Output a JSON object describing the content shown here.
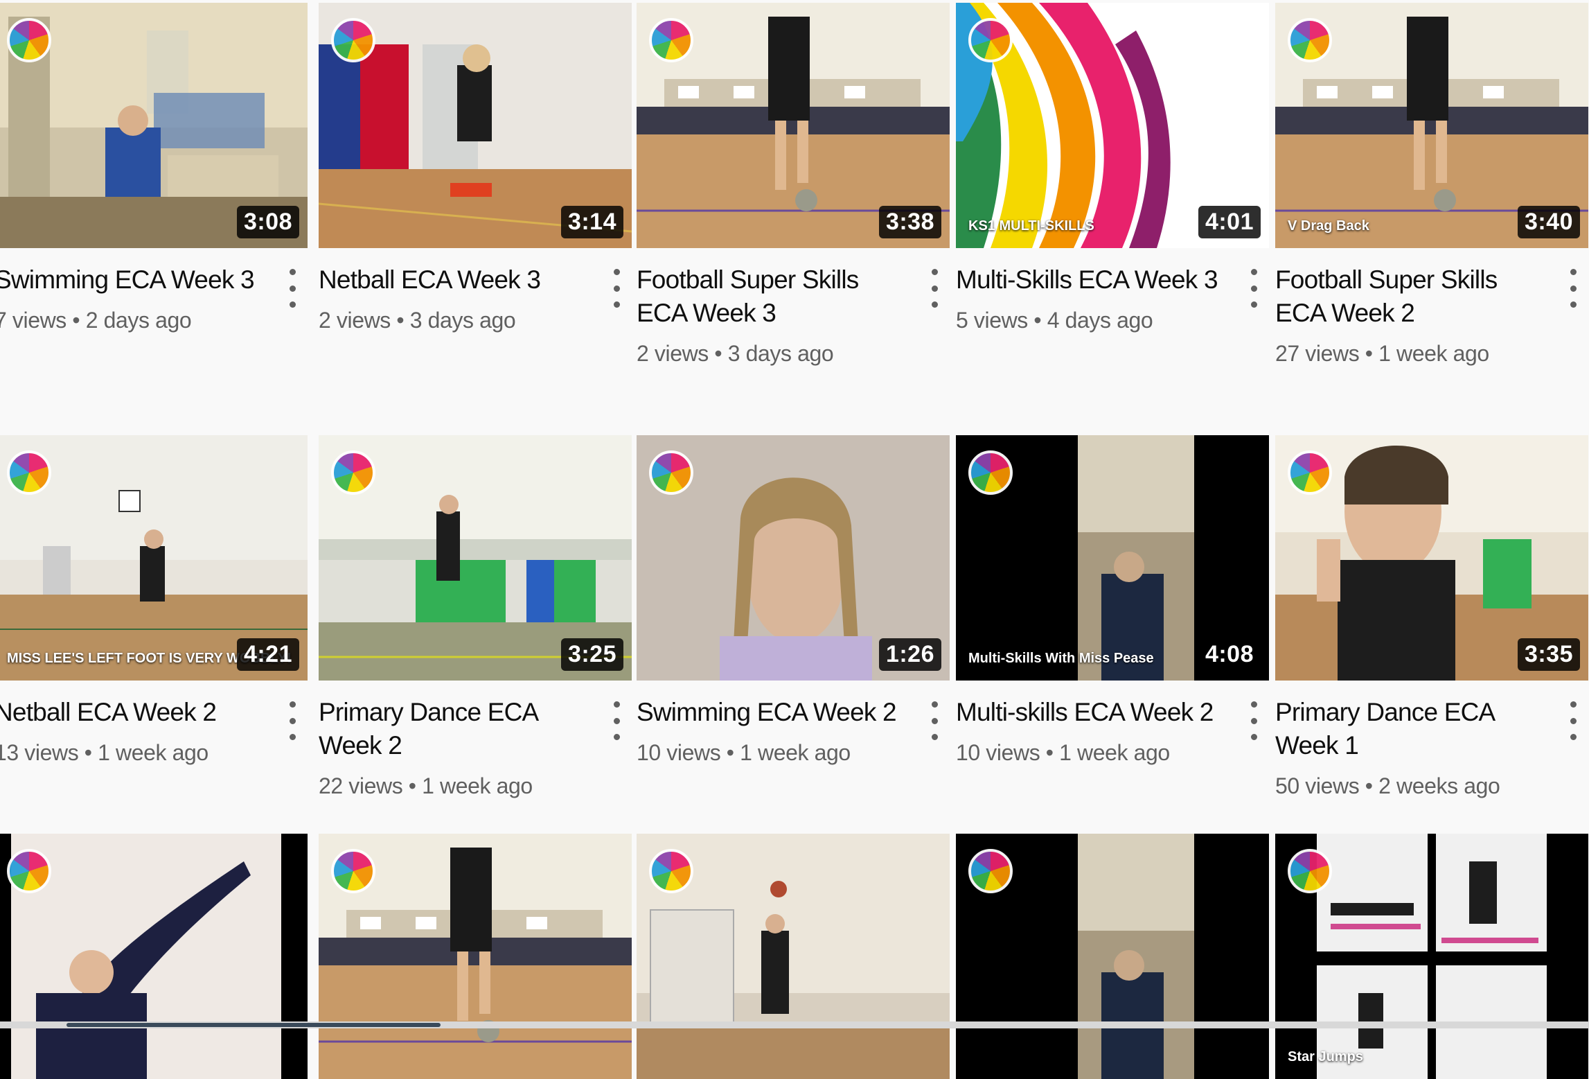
{
  "videos": [
    {
      "title": "Swimming ECA Week 3",
      "views": "7 views",
      "age": "2 days ago",
      "duration": "3:08",
      "thumb_scene": "pool-room"
    },
    {
      "title": "Netball ECA Week 3",
      "views": "2 views",
      "age": "3 days ago",
      "duration": "3:14",
      "thumb_scene": "netball-wall"
    },
    {
      "title": "Football Super Skills ECA Week 3",
      "views": "2 views",
      "age": "3 days ago",
      "duration": "3:38",
      "thumb_scene": "sports-hall"
    },
    {
      "title": "Multi-Skills ECA Week 3",
      "views": "5 views",
      "age": "4 days ago",
      "duration": "4:01",
      "thumb_scene": "multiskills-graphic",
      "overlay": "KS1 MULTI-SKILLS"
    },
    {
      "title": "Football Super Skills ECA Week 2",
      "views": "27 views",
      "age": "1 week ago",
      "duration": "3:40",
      "thumb_scene": "sports-hall",
      "overlay": "V Drag Back"
    },
    {
      "title": "Netball ECA Week 2",
      "views": "13 views",
      "age": "1 week ago",
      "duration": "4:21",
      "thumb_scene": "gym-hall",
      "overlay": "MISS LEE'S LEFT FOOT IS VERY WOBBLY!"
    },
    {
      "title": "Primary Dance ECA Week 2",
      "views": "22 views",
      "age": "1 week ago",
      "duration": "3:25",
      "thumb_scene": "green-hall"
    },
    {
      "title": "Swimming ECA Week 2",
      "views": "10 views",
      "age": "1 week ago",
      "duration": "1:26",
      "thumb_scene": "portrait"
    },
    {
      "title": "Multi-skills ECA Week 2",
      "views": "10 views",
      "age": "1 week ago",
      "duration": "4:08",
      "thumb_scene": "dark-portrait",
      "overlay": "Multi-Skills With Miss Pease"
    },
    {
      "title": "Primary Dance ECA Week 1",
      "views": "50 views",
      "age": "2 weeks ago",
      "duration": "3:35",
      "thumb_scene": "selfie-hall"
    },
    {
      "title": "",
      "views": "",
      "age": "",
      "duration": "",
      "thumb_scene": "stretch"
    },
    {
      "title": "",
      "views": "",
      "age": "",
      "duration": "",
      "thumb_scene": "sports-hall"
    },
    {
      "title": "",
      "views": "",
      "age": "",
      "duration": "",
      "thumb_scene": "door-room"
    },
    {
      "title": "",
      "views": "",
      "age": "",
      "duration": "",
      "thumb_scene": "dark-portrait"
    },
    {
      "title": "",
      "views": "",
      "age": "",
      "duration": "",
      "thumb_scene": "exercise-collage",
      "overlay": "Star Jumps"
    }
  ],
  "colors": {
    "logo_accent": "#e8226c",
    "duration_bg": "#000000",
    "title": "#0f0f0f",
    "meta": "#606060"
  }
}
